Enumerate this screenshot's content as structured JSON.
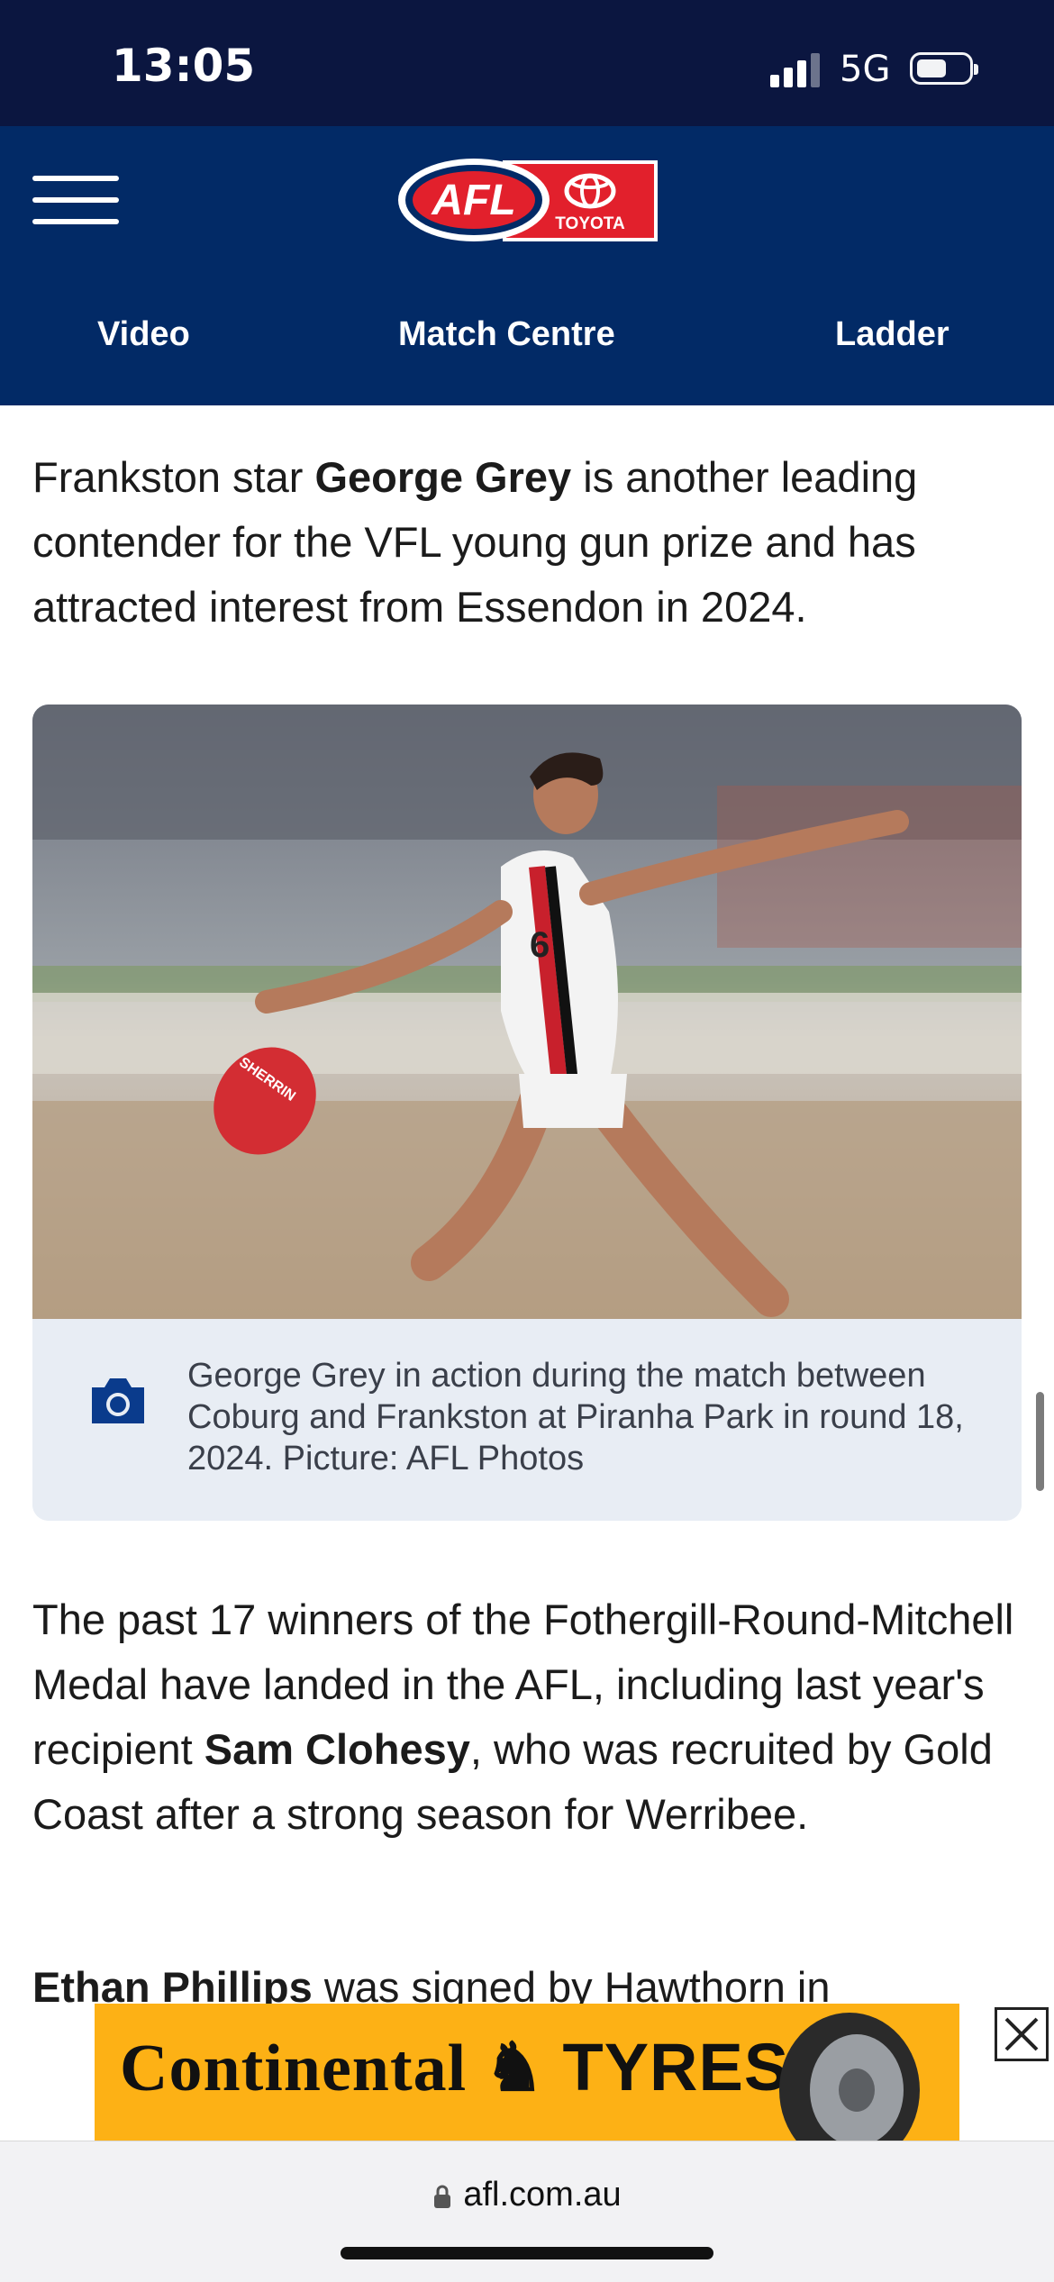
{
  "status_bar": {
    "time": "13:05",
    "network": "5G",
    "battery_level": 0.55
  },
  "header": {
    "logo": {
      "brand": "AFL",
      "sponsor": "TOYOTA"
    },
    "nav": [
      {
        "label": "Video"
      },
      {
        "label": "Match Centre"
      },
      {
        "label": "Ladder"
      }
    ]
  },
  "article": {
    "para1": {
      "pre": "Frankston star ",
      "bold": "George Grey",
      "post": " is another leading contender for the VFL young gun prize and has attracted interest from Essendon in 2024."
    },
    "photo": {
      "caption": "George Grey in action during the match between Coburg and Frankston at Piranha Park in round 18, 2024. Picture: AFL Photos",
      "ball_text": "SHERRIN",
      "jersey_number": "6"
    },
    "para2": {
      "pre": "The past 17 winners of the Fothergill-Round-Mitchell Medal have landed in the AFL, including last year's recipient ",
      "bold": "Sam Clohesy",
      "post": ", who was recruited by Gold Coast after a strong season for Werribee."
    },
    "para3": {
      "bold": "Ethan Phillips",
      "post": " was signed by Hawthorn in"
    }
  },
  "ad": {
    "brand": "Continental",
    "product": "TYRES"
  },
  "browser": {
    "url": "afl.com.au"
  },
  "colors": {
    "header_bg": "#022a66",
    "status_bg": "#0b1640",
    "ad_bg": "#fdb115",
    "afl_red": "#e2202c"
  }
}
